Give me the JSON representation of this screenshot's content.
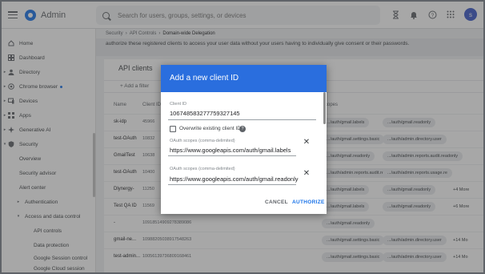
{
  "app": {
    "title": "Admin",
    "avatar_initial": "s"
  },
  "search": {
    "placeholder": "Search for users, groups, settings, or devices"
  },
  "sidebar": {
    "items": [
      {
        "label": "Home",
        "icon": "home-icon"
      },
      {
        "label": "Dashboard",
        "icon": "dashboard-icon"
      },
      {
        "label": "Directory",
        "icon": "person-icon"
      },
      {
        "label": "Chrome browser",
        "icon": "chrome-icon"
      },
      {
        "label": "Devices",
        "icon": "devices-icon"
      },
      {
        "label": "Apps",
        "icon": "apps-icon"
      },
      {
        "label": "Generative AI",
        "icon": "sparkle-icon"
      },
      {
        "label": "Security",
        "icon": "shield-icon"
      },
      {
        "label": "Overview"
      },
      {
        "label": "Security advisor"
      },
      {
        "label": "Alert center"
      },
      {
        "label": "Authentication"
      },
      {
        "label": "Access and data control"
      },
      {
        "label": "API controls"
      },
      {
        "label": "Data protection"
      },
      {
        "label": "Google Session control"
      },
      {
        "label": "Google Cloud session"
      }
    ]
  },
  "breadcrumb": [
    "Security",
    "API Controls",
    "Domain-wide Delegation"
  ],
  "banner": "authorize these registered clients to access your user data without your users having to individually give consent or their passwords.",
  "card": {
    "title": "API clients",
    "add_filter": "Add a filter",
    "columns": [
      "Name",
      "Client ID",
      "Scopes"
    ]
  },
  "rows": [
    {
      "name": "sk-idp",
      "id": "45966",
      "chips": [
        ".../auth/gmail.labels",
        ".../auth/gmail.readonly"
      ],
      "more": ""
    },
    {
      "name": "test-OAuth",
      "id": "10832",
      "chips": [
        ".../auth/gmail.settings.basic",
        ".../auth/admin.directory.user"
      ],
      "more": ""
    },
    {
      "name": "GmailTest",
      "id": "10638",
      "chips": [
        ".../auth/gmail.readonly",
        ".../auth/admin.reports.audit.readonly"
      ],
      "more": ""
    },
    {
      "name": "test-OAuth",
      "id": "10400",
      "chips": [
        ".../auth/admin.reports.audit.readonly",
        ".../auth/admin.reports.usage.re"
      ],
      "more": ""
    },
    {
      "name": "Dlynergy-",
      "id": "11250",
      "chips": [
        ".../auth/gmail.labels",
        ".../auth/gmail.readonly"
      ],
      "more": "+4 More"
    },
    {
      "name": "Test QA ID",
      "id": "11569",
      "chips": [
        ".../auth/gmail.labels",
        ".../auth/gmail.readonly"
      ],
      "more": "+6 More"
    },
    {
      "name": "-",
      "id": "10918514909278389086",
      "chips": [
        ".../auth/gmail.readonly"
      ],
      "more": ""
    },
    {
      "name": "gmail-ne...",
      "id": "10988205038917548263",
      "chips": [
        ".../auth/gmail.settings.basic",
        ".../auth/admin.directory.user"
      ],
      "more": "+14 Mo"
    },
    {
      "name": "test-admin...",
      "id": "10056139736809168461",
      "chips": [
        ".../auth/gmail.settings.basic",
        ".../auth/admin.directory.user"
      ],
      "more": "+14 Mo"
    }
  ],
  "dialog": {
    "title": "Add a new client ID",
    "client_id_label": "Client ID",
    "client_id_value": "106748583277759327145",
    "overwrite_label": "Overwrite existing client ID",
    "help_glyph": "?",
    "scope_label": "OAuth scopes (comma-delimited)",
    "scope1": "https://www.googleapis.com/auth/gmail.labels",
    "scope2": "https://www.googleapis.com/auth/gmail.readonly",
    "cancel": "CANCEL",
    "authorize": "AUTHORIZE"
  }
}
